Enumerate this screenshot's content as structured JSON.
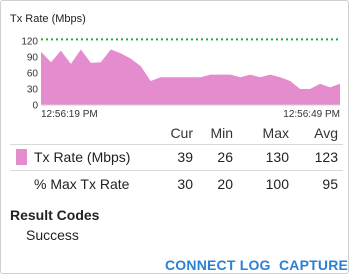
{
  "chart_data": {
    "type": "area",
    "title": "Tx Rate (Mbps)",
    "xlabel": "",
    "ylabel": "",
    "x_ticks": [
      "12:56:19 PM",
      "12:56:49 PM"
    ],
    "y_ticks": [
      0,
      30,
      60,
      90,
      120
    ],
    "ylim": [
      0,
      135
    ],
    "grid": false,
    "series": [
      {
        "name": "Tx Rate (Mbps)",
        "color": "#e58ccf",
        "values": [
          100,
          80,
          102,
          77,
          104,
          79,
          80,
          104,
          97,
          87,
          73,
          45,
          52,
          52,
          52,
          52,
          52,
          57,
          57,
          57,
          52,
          57,
          52,
          57,
          52,
          45,
          30,
          30,
          40,
          33,
          40
        ]
      },
      {
        "name": "Max",
        "color": "#2aa24a",
        "style": "dotted",
        "values": [
          123,
          123
        ]
      }
    ]
  },
  "stats": {
    "headers": [
      "Cur",
      "Min",
      "Max",
      "Avg"
    ],
    "rows": [
      {
        "label": "Tx Rate (Mbps)",
        "values": [
          "39",
          "26",
          "130",
          "123"
        ]
      },
      {
        "label": "% Max Tx Rate",
        "values": [
          "30",
          "20",
          "100",
          "95"
        ]
      }
    ]
  },
  "result_codes": {
    "title": "Result Codes",
    "value": "Success"
  },
  "actions": {
    "connect_log": "CONNECT LOG",
    "capture": "CAPTURE"
  },
  "colors": {
    "accent": "#2a7fd6",
    "series": "#e58ccf",
    "max_line": "#2aa24a"
  }
}
